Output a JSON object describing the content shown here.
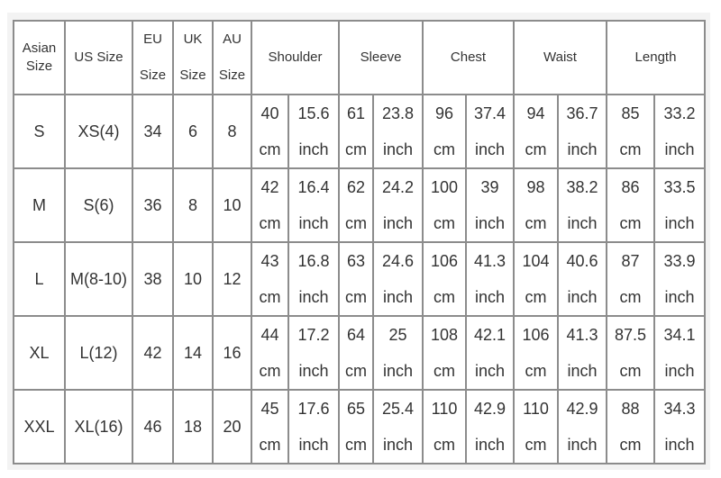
{
  "headers": {
    "asian": [
      "Asian",
      "Size"
    ],
    "us": "US Size",
    "eu": [
      "EU",
      "Size"
    ],
    "uk": [
      "UK",
      "Size"
    ],
    "au": [
      "AU",
      "Size"
    ],
    "measurements": [
      "Shoulder",
      "Sleeve",
      "Chest",
      "Waist",
      "Length"
    ]
  },
  "units": {
    "cm": "cm",
    "inch": "inch"
  },
  "rows": [
    {
      "asian": "S",
      "us": "XS(4)",
      "eu": "34",
      "uk": "6",
      "au": "8",
      "m": [
        [
          "40",
          "15.6"
        ],
        [
          "61",
          "23.8"
        ],
        [
          "96",
          "37.4"
        ],
        [
          "94",
          "36.7"
        ],
        [
          "85",
          "33.2"
        ]
      ]
    },
    {
      "asian": "M",
      "us": "S(6)",
      "eu": "36",
      "uk": "8",
      "au": "10",
      "m": [
        [
          "42",
          "16.4"
        ],
        [
          "62",
          "24.2"
        ],
        [
          "100",
          "39"
        ],
        [
          "98",
          "38.2"
        ],
        [
          "86",
          "33.5"
        ]
      ]
    },
    {
      "asian": "L",
      "us": "M(8-10)",
      "eu": "38",
      "uk": "10",
      "au": "12",
      "m": [
        [
          "43",
          "16.8"
        ],
        [
          "63",
          "24.6"
        ],
        [
          "106",
          "41.3"
        ],
        [
          "104",
          "40.6"
        ],
        [
          "87",
          "33.9"
        ]
      ]
    },
    {
      "asian": "XL",
      "us": "L(12)",
      "eu": "42",
      "uk": "14",
      "au": "16",
      "m": [
        [
          "44",
          "17.2"
        ],
        [
          "64",
          "25"
        ],
        [
          "108",
          "42.1"
        ],
        [
          "106",
          "41.3"
        ],
        [
          "87.5",
          "34.1"
        ]
      ]
    },
    {
      "asian": "XXL",
      "us": "XL(16)",
      "eu": "46",
      "uk": "18",
      "au": "20",
      "m": [
        [
          "45",
          "17.6"
        ],
        [
          "65",
          "25.4"
        ],
        [
          "110",
          "42.9"
        ],
        [
          "110",
          "42.9"
        ],
        [
          "88",
          "34.3"
        ]
      ]
    }
  ]
}
